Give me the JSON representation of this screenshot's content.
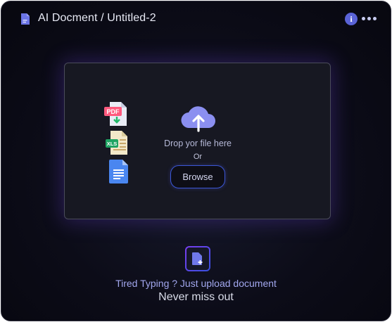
{
  "header": {
    "title": "AI Docment / Untitled-2",
    "icons": {
      "doc": "document-icon",
      "info": "info-icon",
      "more": "more-options-icon"
    },
    "info_glyph": "i"
  },
  "dropzone": {
    "file_types": [
      "pdf",
      "xls",
      "google-doc"
    ],
    "drop_label": "Drop yor file here",
    "or_label": "Or",
    "browse_label": "Browse",
    "icon": "cloud-upload-icon"
  },
  "footer": {
    "icon": "upload-document-icon",
    "tagline": "Tired Typing ? Just upload document",
    "subtag": "Never miss out"
  },
  "colors": {
    "accent": "#5a63d6",
    "cloud": "#8b8ff0",
    "tagline": "#a2a7ee"
  }
}
